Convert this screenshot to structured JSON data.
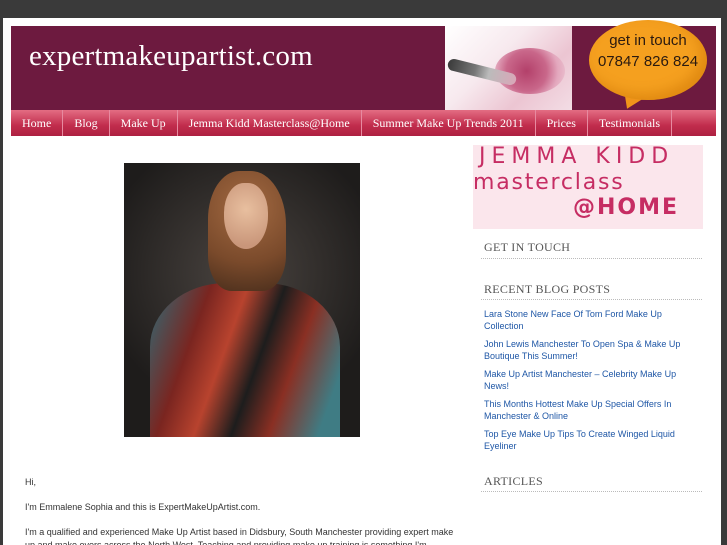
{
  "header": {
    "site_title": "expertmakeupartist.com",
    "bubble_line1": "get in touch",
    "bubble_line2": "07847 826 824"
  },
  "nav": {
    "items": [
      "Home",
      "Blog",
      "Make Up",
      "Jemma Kidd Masterclass@Home",
      "Summer Make Up Trends 2011",
      "Prices",
      "Testimonials"
    ]
  },
  "content": {
    "greeting": "Hi,",
    "intro": "I'm Emmalene Sophia and this is ExpertMakeUpArtist.com.",
    "paragraph": "I'm a qualified and experienced Make Up Artist based in Didsbury, South Manchester providing expert make up and make overs across the North West. Teaching and providing make up training is something I'm"
  },
  "sidebar": {
    "banner": {
      "line1": "JEMMA KIDD",
      "line2": "masterclass",
      "line3": "@HOME"
    },
    "get_in_touch": "GET IN TOUCH",
    "recent_posts_heading": "RECENT BLOG POSTS",
    "recent_posts": [
      "Lara Stone New Face Of Tom Ford Make Up Collection",
      "John Lewis Manchester To Open Spa & Make Up Boutique This Summer!",
      "Make Up Artist Manchester – Celebrity Make Up News!",
      "This Months Hottest Make Up Special Offers In Manchester & Online",
      "Top Eye Make Up Tips To Create Winged Liquid Eyeliner"
    ],
    "articles_heading": "ARTICLES"
  },
  "colors": {
    "header_bg": "#6d1a3f",
    "nav_bg": "#c12c4c",
    "bubble": "#f5a01f",
    "banner_text": "#c62d63",
    "link": "#1f57a6"
  }
}
